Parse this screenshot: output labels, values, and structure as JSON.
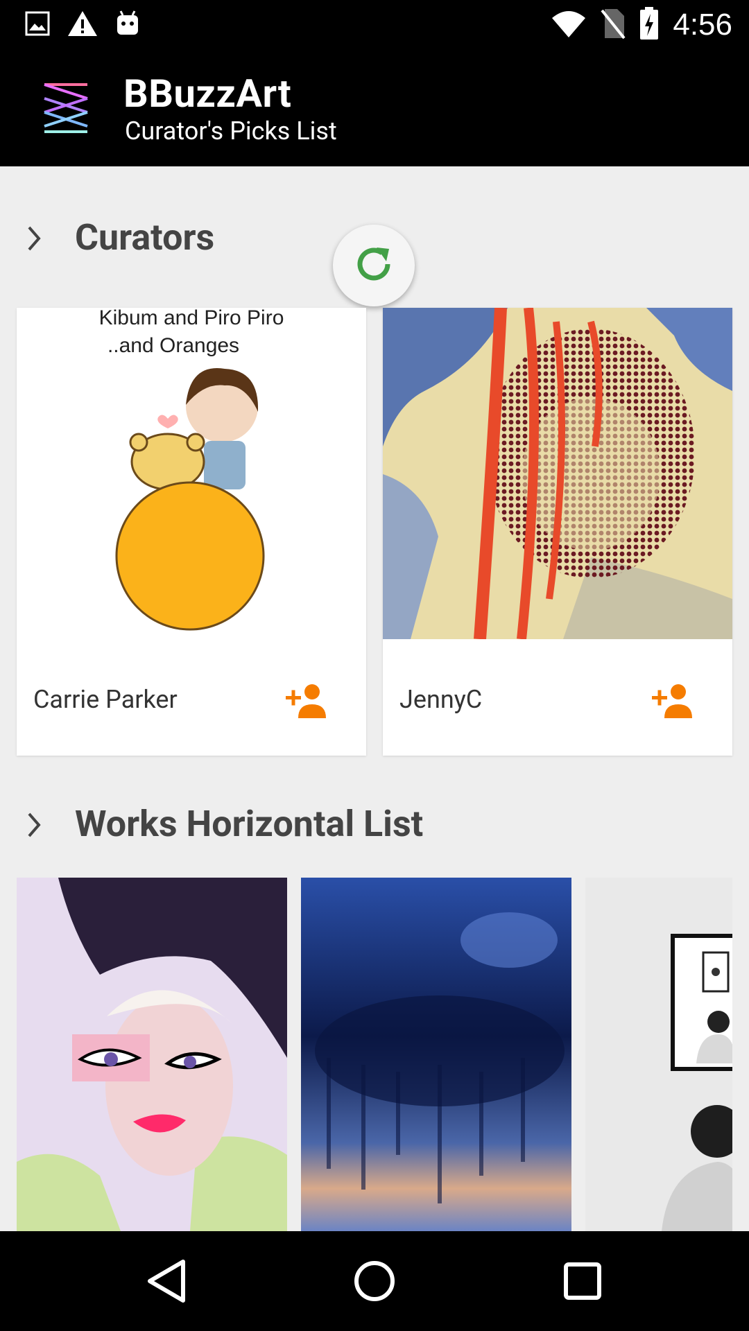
{
  "status_bar": {
    "time": "4:56",
    "left_icons": [
      "image-icon",
      "warning-icon",
      "android-icon"
    ],
    "right_icons": [
      "wifi-icon",
      "no-sim-icon",
      "battery-charging-icon"
    ]
  },
  "app_bar": {
    "title": "BBuzzArt",
    "subtitle": "Curator's Picks List"
  },
  "sections": {
    "curators": {
      "title": "Curators"
    },
    "works": {
      "title": "Works Horizontal List"
    }
  },
  "curators": [
    {
      "name": "Carrie Parker",
      "image_caption_line1": "Kibum and Piro Piro",
      "image_caption_line2": "..and Oranges"
    },
    {
      "name": "JennyC"
    }
  ],
  "colors": {
    "accent_orange": "#f57c00",
    "refresh_green": "#43a047",
    "app_bar_bg": "#000000",
    "background": "#eeeeee"
  },
  "nav_bar": {
    "buttons": [
      "back-icon",
      "home-icon",
      "recents-icon"
    ]
  }
}
